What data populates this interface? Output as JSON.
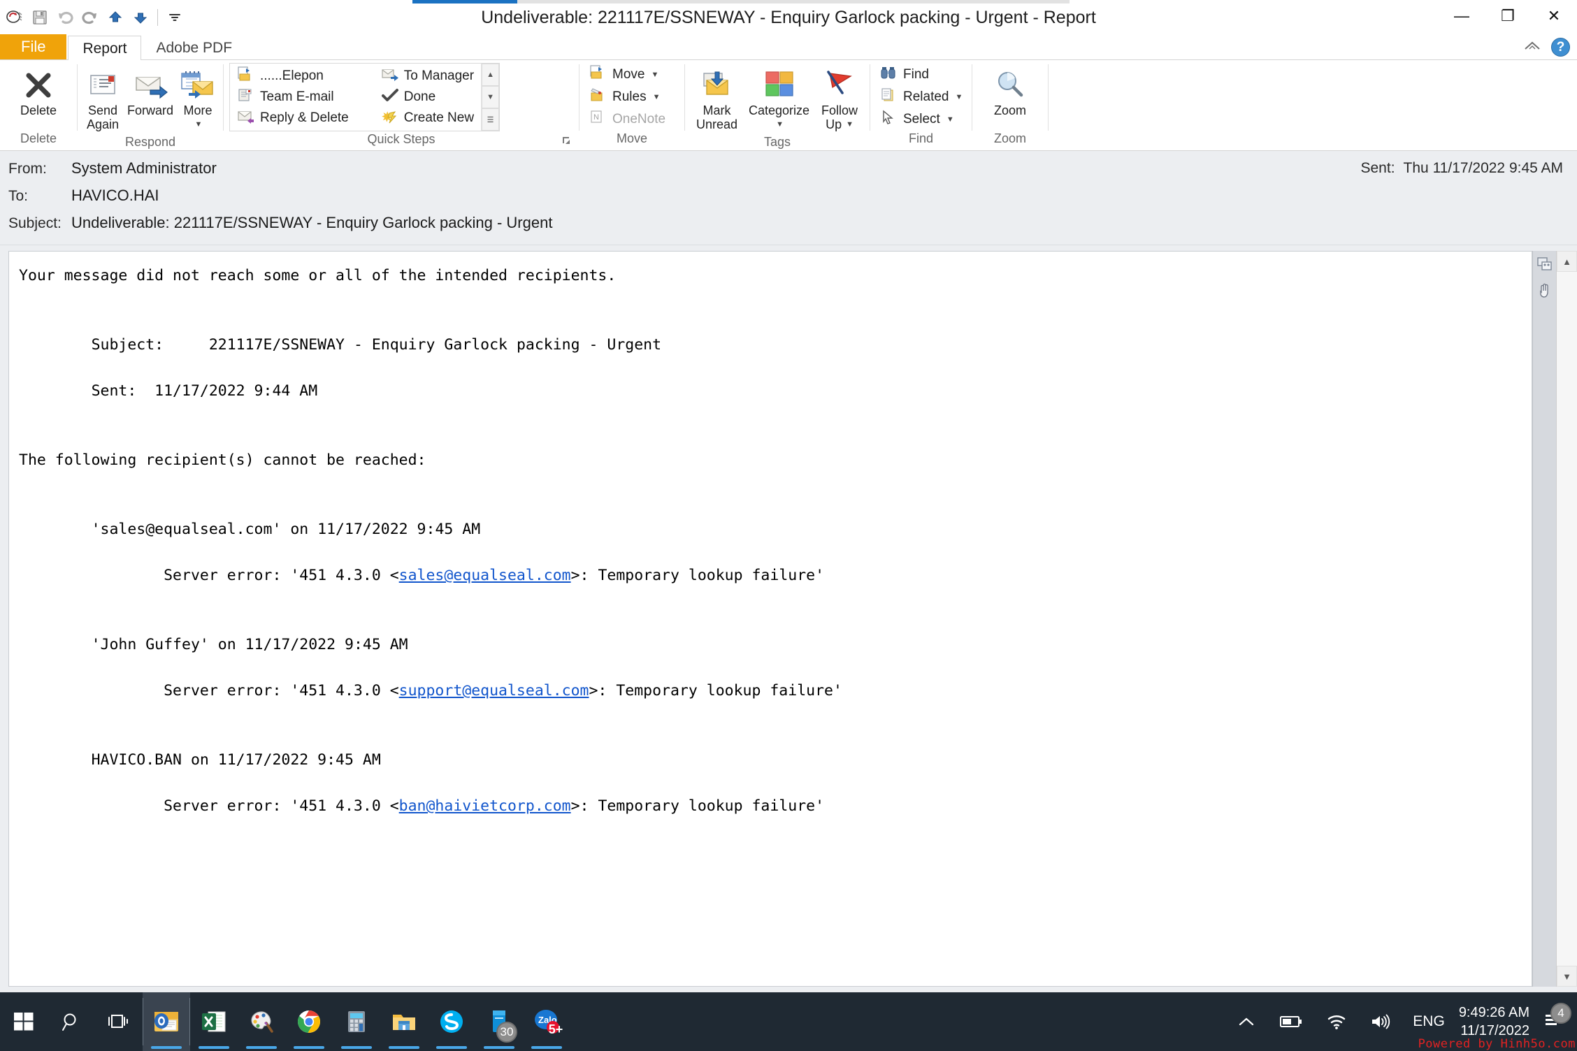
{
  "window": {
    "title": "Undeliverable: 221117E/SSNEWAY - Enquiry Garlock packing - Urgent  -  Report",
    "minimize_label": "—",
    "restore_label": "❐",
    "close_label": "✕"
  },
  "quick_access": {
    "items": [
      {
        "name": "outlook-send-receive-icon",
        "label": ""
      },
      {
        "name": "save-icon",
        "label": ""
      },
      {
        "name": "undo-icon",
        "label": ""
      },
      {
        "name": "redo-icon",
        "label": ""
      },
      {
        "name": "previous-item-icon",
        "label": ""
      },
      {
        "name": "next-item-icon",
        "label": ""
      },
      {
        "name": "customize-qat-icon",
        "label": ""
      }
    ]
  },
  "ribbon": {
    "tabs": [
      {
        "label": "File",
        "active": false,
        "kind": "file"
      },
      {
        "label": "Report",
        "active": true,
        "kind": "normal"
      },
      {
        "label": "Adobe PDF",
        "active": false,
        "kind": "normal"
      }
    ],
    "groups": {
      "delete": {
        "label": "Delete",
        "buttons": [
          {
            "label": "Delete",
            "icon": "delete-x-icon"
          }
        ]
      },
      "respond": {
        "label": "Respond",
        "buttons": [
          {
            "label": "Send\nAgain",
            "line1": "Send",
            "line2": "Again",
            "icon": "send-again-icon"
          },
          {
            "label": "Forward",
            "line1": "Forward",
            "line2": "",
            "icon": "forward-icon"
          },
          {
            "label": "More",
            "line1": "More",
            "line2": "",
            "icon": "more-respond-icon"
          }
        ]
      },
      "quick_steps": {
        "label": "Quick Steps",
        "left_column": [
          {
            "label": "......Elepon",
            "icon": "move-to-folder-icon"
          },
          {
            "label": "Team E-mail",
            "icon": "team-email-icon"
          },
          {
            "label": "Reply & Delete",
            "icon": "reply-delete-icon"
          }
        ],
        "right_column": [
          {
            "label": "To Manager",
            "icon": "to-manager-icon"
          },
          {
            "label": "Done",
            "icon": "done-check-icon"
          },
          {
            "label": "Create New",
            "icon": "create-new-icon"
          }
        ],
        "scroll_up": "▲",
        "scroll_down": "▼",
        "scroll_more": "☰"
      },
      "move": {
        "label": "Move",
        "buttons": [
          {
            "label": "Move",
            "icon": "move-folder-icon",
            "has_caret": true,
            "disabled": false
          },
          {
            "label": "Rules",
            "icon": "rules-icon",
            "has_caret": true,
            "disabled": false
          },
          {
            "label": "OneNote",
            "icon": "onenote-icon",
            "has_caret": false,
            "disabled": true
          }
        ]
      },
      "tags": {
        "label": "Tags",
        "buttons": [
          {
            "line1": "Mark",
            "line2": "Unread",
            "icon": "mark-unread-icon",
            "has_caret": false
          },
          {
            "line1": "Categorize",
            "line2": "",
            "icon": "categorize-icon",
            "has_caret": true
          },
          {
            "line1": "Follow",
            "line2": "Up",
            "icon": "follow-up-flag-icon",
            "has_caret": true
          }
        ]
      },
      "find": {
        "label": "Find",
        "buttons": [
          {
            "label": "Find",
            "icon": "find-binoculars-icon",
            "has_caret": false
          },
          {
            "label": "Related",
            "icon": "related-icon",
            "has_caret": true
          },
          {
            "label": "Select",
            "icon": "select-pointer-icon",
            "has_caret": true
          }
        ]
      },
      "zoom": {
        "label": "Zoom",
        "buttons": [
          {
            "label": "Zoom",
            "icon": "zoom-magnifier-icon"
          }
        ]
      }
    }
  },
  "message": {
    "from_label": "From:",
    "from_value": "System Administrator",
    "to_label": "To:",
    "to_value": "HAVICO.HAI",
    "subject_label": "Subject:",
    "subject_value": "Undeliverable: 221117E/SSNEWAY - Enquiry Garlock packing - Urgent",
    "sent_label": "Sent:",
    "sent_value": "Thu 11/17/2022 9:45 AM"
  },
  "body": {
    "intro": "Your message did not reach some or all of the intended recipients.",
    "orig_subject_label": "        Subject:     ",
    "orig_subject_value": "221117E/SSNEWAY - Enquiry Garlock packing - Urgent",
    "orig_sent_line": "        Sent:  11/17/2022 9:44 AM",
    "following_line": "The following recipient(s) cannot be reached:",
    "recipients": [
      {
        "header": "        'sales@equalseal.com' on 11/17/2022 9:45 AM",
        "error_prefix": "                Server error: '451 4.3.0 <",
        "error_link": "sales@equalseal.com",
        "error_suffix": ">: Temporary lookup failure'"
      },
      {
        "header": "        'John Guffey' on 11/17/2022 9:45 AM",
        "error_prefix": "                Server error: '451 4.3.0 <",
        "error_link": "support@equalseal.com",
        "error_suffix": ">: Temporary lookup failure'"
      },
      {
        "header": "        HAVICO.BAN on 11/17/2022 9:45 AM",
        "error_prefix": "                Server error: '451 4.3.0 <",
        "error_link": "ban@haivietcorp.com",
        "error_suffix": ">: Temporary lookup failure'"
      }
    ]
  },
  "side_rail": {
    "icons": [
      {
        "name": "people-pane-icon"
      },
      {
        "name": "hand-pan-icon"
      }
    ],
    "scroll_up": "▲",
    "scroll_down": "▼"
  },
  "taskbar": {
    "start_label": "start-button",
    "items": [
      {
        "name": "start-button",
        "icon": "windows-logo-icon",
        "running": false
      },
      {
        "name": "search-button",
        "icon": "search-icon",
        "running": false
      },
      {
        "name": "task-view-button",
        "icon": "task-view-icon",
        "running": false
      },
      {
        "name": "taskbar-app-outlook",
        "icon": "outlook-icon",
        "running": true,
        "active": true
      },
      {
        "name": "taskbar-app-excel",
        "icon": "excel-icon",
        "running": true,
        "active": false
      },
      {
        "name": "taskbar-app-paint",
        "icon": "paint-icon",
        "running": true,
        "active": false
      },
      {
        "name": "taskbar-app-chrome",
        "icon": "chrome-icon",
        "running": true,
        "active": false
      },
      {
        "name": "taskbar-app-calculator",
        "icon": "calculator-icon",
        "running": true,
        "active": false
      },
      {
        "name": "taskbar-app-file-explorer",
        "icon": "folder-icon",
        "running": true,
        "active": false
      },
      {
        "name": "taskbar-app-skype",
        "icon": "skype-icon",
        "running": true,
        "active": false
      },
      {
        "name": "taskbar-app-zalo-pc",
        "icon": "zalo-pc-icon",
        "running": true,
        "active": false,
        "badge": "30"
      },
      {
        "name": "taskbar-app-zalo",
        "icon": "zalo-icon",
        "running": true,
        "active": false,
        "badge": "5+"
      }
    ],
    "tray": {
      "show_hidden": "⌃",
      "battery": "battery-icon",
      "network": "wifi-icon",
      "volume": "volume-icon",
      "language": "ENG",
      "clock_time": "9:49:26 AM",
      "clock_date": "11/17/2022",
      "action_center_badge": "4"
    },
    "watermark": "Powered by Hinh5o.com"
  },
  "colors": {
    "file_tab": "#f0a30a",
    "accent_blue": "#1b72c2",
    "link": "#1155cc",
    "header_bg": "#eceef1",
    "taskbar_bg": "#1f2933"
  }
}
